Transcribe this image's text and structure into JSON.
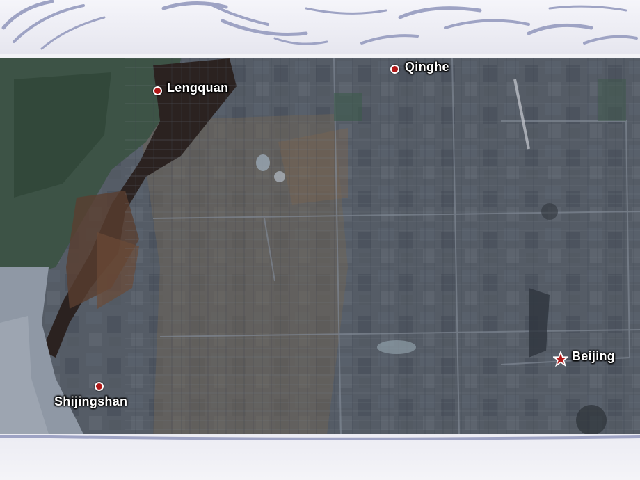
{
  "map": {
    "places": {
      "qinghe": {
        "label": "Qinghe",
        "marker": "place-dot-icon"
      },
      "lengquan": {
        "label": "Lengquan",
        "marker": "place-dot-icon"
      },
      "beijing": {
        "label": "Beijing",
        "marker": "capital-star-icon"
      },
      "shijingshan": {
        "label": "Shijingshan",
        "marker": "place-dot-icon"
      }
    },
    "colors": {
      "marker_fill": "#b01818",
      "marker_outline": "#ffffff",
      "label_text": "#ffffff",
      "decoration_stroke": "#9ea3c4"
    }
  }
}
